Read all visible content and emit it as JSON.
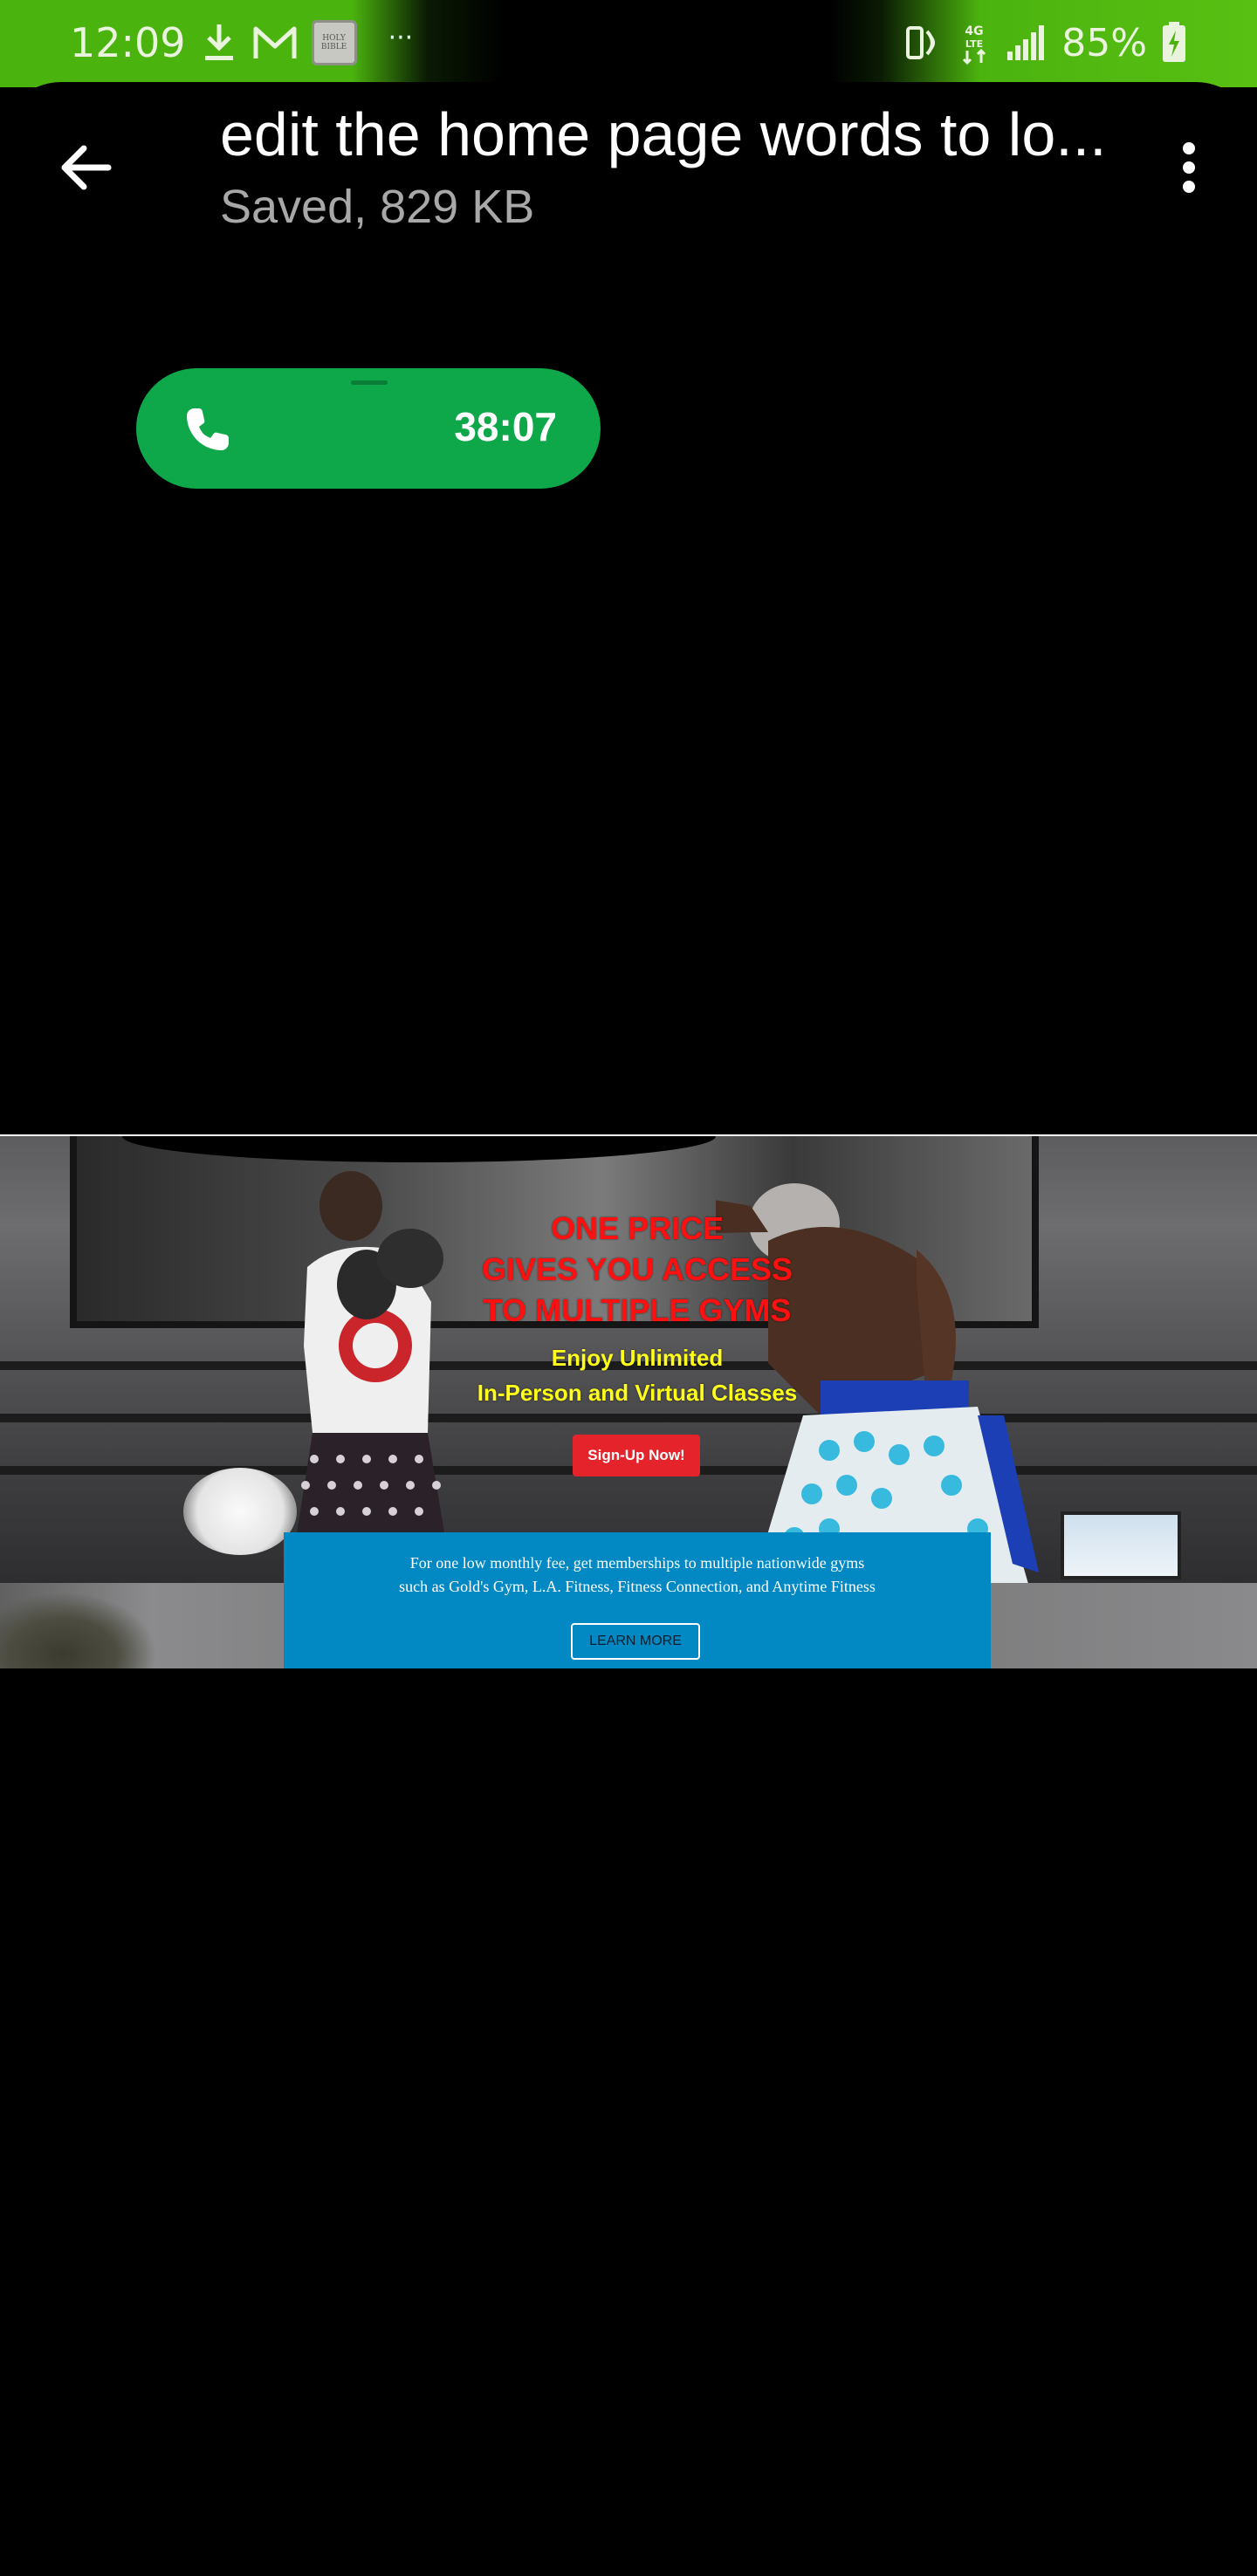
{
  "status_bar": {
    "time": "12:09",
    "battery": "85%",
    "notification_icons": [
      "download-icon",
      "gmail-icon",
      "holy-bible-icon"
    ],
    "bible_icon_text": "HOLY BIBLE",
    "overflow": "···",
    "system_icons": [
      "vibrate-icon",
      "4g-lte-icon",
      "signal-icon",
      "battery-charging-icon"
    ],
    "network_label": "4G LTE",
    "accent_color": "#4bb30e"
  },
  "header": {
    "title": "edit the home page words to lo...",
    "subtitle": "Saved, 829 KB",
    "back_icon": "back-arrow-icon",
    "menu_icon": "more-vert-icon"
  },
  "call": {
    "timer": "38:07",
    "icon": "phone-icon",
    "color": "#0ea84a"
  },
  "web_preview": {
    "headline": [
      "ONE PRICE",
      "GIVES YOU ACCESS",
      "TO MULTIPLE GYMS"
    ],
    "sub": [
      "Enjoy Unlimited",
      "In-Person and Virtual Classes"
    ],
    "signup_label": "Sign-Up Now!",
    "info_text": [
      "For one low monthly fee, get memberships to multiple nationwide gyms",
      "such as Gold's Gym, L.A. Fitness, Fitness Connection, and Anytime Fitness"
    ],
    "learn_more_label": "LEARN MORE",
    "headline_color": "#ff1010",
    "sub_color": "#ffff1a",
    "button_color": "#e4232a",
    "info_color": "#0289c3"
  }
}
